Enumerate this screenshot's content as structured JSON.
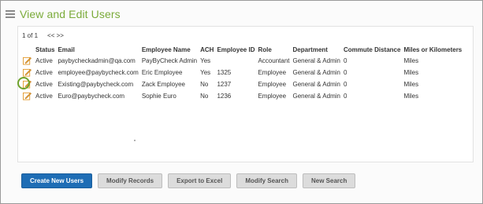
{
  "header": {
    "title": "View and Edit Users"
  },
  "pager": {
    "summary": "1 of 1",
    "nav": "<< >>"
  },
  "table": {
    "columns": [
      "Status",
      "Email",
      "Employee Name",
      "ACH",
      "Employee ID",
      "Role",
      "Department",
      "Commute Distance",
      "Miles or Kilometers"
    ],
    "rows": [
      {
        "status": "Active",
        "email": "paybycheckadmin@qa.com",
        "name": "PayByCheck Admin",
        "ach": "Yes",
        "employee_id": "",
        "role": "Accountant",
        "department": "General & Admin",
        "commute": "0",
        "unit": "Miles"
      },
      {
        "status": "Active",
        "email": "employee@paybycheck.com",
        "name": "Eric Employee",
        "ach": "Yes",
        "employee_id": "1325",
        "role": "Employee",
        "department": "General & Admin",
        "commute": "0",
        "unit": "Miles"
      },
      {
        "status": "Active",
        "email": "Existing@paybycheck.com",
        "name": "Zack Employee",
        "ach": "No",
        "employee_id": "1237",
        "role": "Employee",
        "department": "General & Admin",
        "commute": "0",
        "unit": "Miles"
      },
      {
        "status": "Active",
        "email": "Euro@paybycheck.com",
        "name": "Sophie Euro",
        "ach": "No",
        "employee_id": "1236",
        "role": "Employee",
        "department": "General & Admin",
        "commute": "0",
        "unit": "Miles"
      }
    ]
  },
  "buttons": {
    "create": "Create New Users",
    "modify_records": "Modify Records",
    "export": "Export to Excel",
    "modify_search": "Modify Search",
    "new_search": "New Search"
  },
  "colors": {
    "accent": "#7bab3a",
    "primary_button": "#1e6db5",
    "highlight": "#6fa32c"
  },
  "icons": {
    "menu": "hamburger-menu-icon",
    "edit": "edit-pencil-icon"
  }
}
